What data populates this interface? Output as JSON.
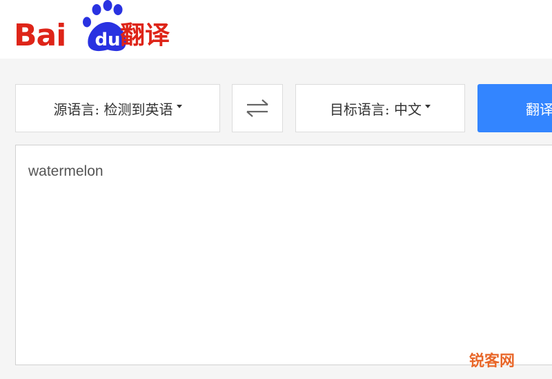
{
  "logo": {
    "text": "Bai",
    "badge_text": "du",
    "cn_text": "翻译",
    "brand_color": "#de2418",
    "paw_color": "#2932e1"
  },
  "toolbar": {
    "source_lang_label": "源语言: 检测到英语",
    "swap_icon": "swap-arrows-icon",
    "target_lang_label": "目标语言: 中文",
    "translate_label": "翻译",
    "accent_color": "#3385ff"
  },
  "input": {
    "value": "watermelon"
  },
  "watermark": {
    "text": "锐客网"
  }
}
